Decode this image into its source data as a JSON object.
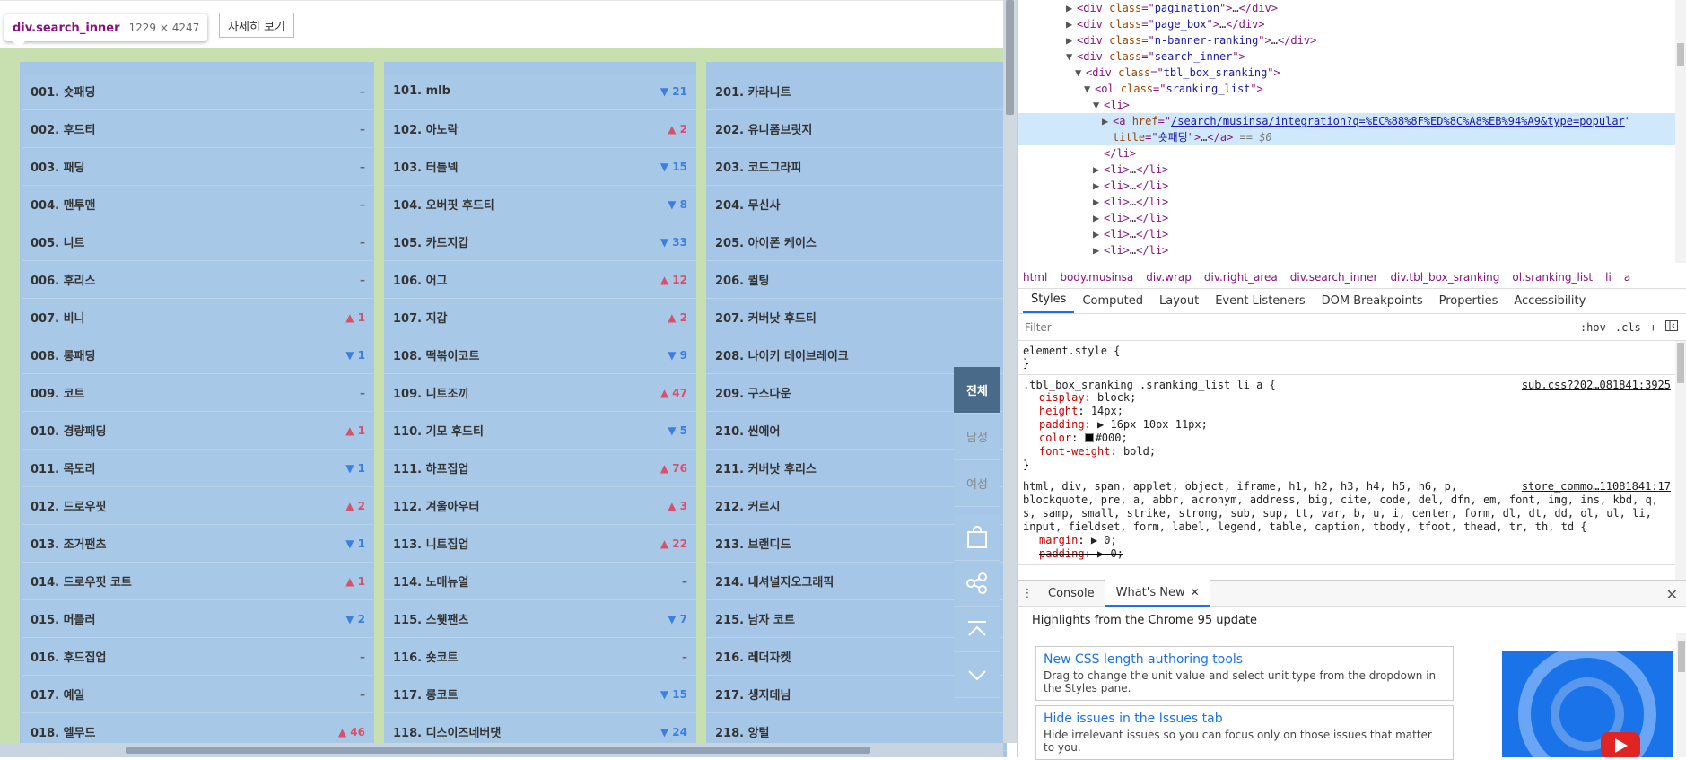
{
  "tooltip": {
    "tag": "div.search_inner",
    "size": "1229 × 4247"
  },
  "detail_button": "자세히 보기",
  "ranking": {
    "col1": [
      {
        "name": "001. 숏패딩",
        "change": "–",
        "dir": "same"
      },
      {
        "name": "002. 후드티",
        "change": "–",
        "dir": "same"
      },
      {
        "name": "003. 패딩",
        "change": "–",
        "dir": "same"
      },
      {
        "name": "004. 맨투맨",
        "change": "–",
        "dir": "same"
      },
      {
        "name": "005. 니트",
        "change": "–",
        "dir": "same"
      },
      {
        "name": "006. 후리스",
        "change": "–",
        "dir": "same"
      },
      {
        "name": "007. 비니",
        "change": "▲ 1",
        "dir": "up"
      },
      {
        "name": "008. 롱패딩",
        "change": "▼ 1",
        "dir": "down"
      },
      {
        "name": "009. 코트",
        "change": "–",
        "dir": "same"
      },
      {
        "name": "010. 경량패딩",
        "change": "▲ 1",
        "dir": "up"
      },
      {
        "name": "011. 목도리",
        "change": "▼ 1",
        "dir": "down"
      },
      {
        "name": "012. 드로우핏",
        "change": "▲ 2",
        "dir": "up"
      },
      {
        "name": "013. 조거팬츠",
        "change": "▼ 1",
        "dir": "down"
      },
      {
        "name": "014. 드로우핏 코트",
        "change": "▲ 1",
        "dir": "up"
      },
      {
        "name": "015. 머플러",
        "change": "▼ 2",
        "dir": "down"
      },
      {
        "name": "016. 후드집업",
        "change": "–",
        "dir": "same"
      },
      {
        "name": "017. 예일",
        "change": "–",
        "dir": "same"
      },
      {
        "name": "018. 엘무드",
        "change": "▲ 46",
        "dir": "up"
      }
    ],
    "col2": [
      {
        "name": "101. mlb",
        "change": "▼ 21",
        "dir": "down"
      },
      {
        "name": "102. 아노락",
        "change": "▲ 2",
        "dir": "up"
      },
      {
        "name": "103. 터틀넥",
        "change": "▼ 15",
        "dir": "down"
      },
      {
        "name": "104. 오버핏 후드티",
        "change": "▼ 8",
        "dir": "down"
      },
      {
        "name": "105. 카드지갑",
        "change": "▼ 33",
        "dir": "down"
      },
      {
        "name": "106. 어그",
        "change": "▲ 12",
        "dir": "up"
      },
      {
        "name": "107. 지갑",
        "change": "▲ 2",
        "dir": "up"
      },
      {
        "name": "108. 떡볶이코트",
        "change": "▼ 9",
        "dir": "down"
      },
      {
        "name": "109. 니트조끼",
        "change": "▲ 47",
        "dir": "up"
      },
      {
        "name": "110. 기모 후드티",
        "change": "▼ 5",
        "dir": "down"
      },
      {
        "name": "111. 하프집업",
        "change": "▲ 76",
        "dir": "up"
      },
      {
        "name": "112. 겨울아우터",
        "change": "▲ 3",
        "dir": "up"
      },
      {
        "name": "113. 니트집업",
        "change": "▲ 22",
        "dir": "up"
      },
      {
        "name": "114. 노매뉴얼",
        "change": "–",
        "dir": "same"
      },
      {
        "name": "115. 스웻팬츠",
        "change": "▼ 7",
        "dir": "down"
      },
      {
        "name": "116. 숏코트",
        "change": "–",
        "dir": "same"
      },
      {
        "name": "117. 롱코트",
        "change": "▼ 15",
        "dir": "down"
      },
      {
        "name": "118. 디스이즈네버댓",
        "change": "▼ 24",
        "dir": "down"
      }
    ],
    "col3": [
      {
        "name": "201. 카라니트"
      },
      {
        "name": "202. 유니폼브릿지"
      },
      {
        "name": "203. 코드그라피"
      },
      {
        "name": "204. 무신사"
      },
      {
        "name": "205. 아이폰 케이스"
      },
      {
        "name": "206. 퀼팅"
      },
      {
        "name": "207. 커버낫 후드티"
      },
      {
        "name": "208. 나이키 데이브레이크"
      },
      {
        "name": "209. 구스다운"
      },
      {
        "name": "210. 씬에어"
      },
      {
        "name": "211. 커버낫 후리스"
      },
      {
        "name": "212. 커르시"
      },
      {
        "name": "213. 브랜디드"
      },
      {
        "name": "214. 내셔널지오그래픽"
      },
      {
        "name": "215. 남자 코트"
      },
      {
        "name": "216. 레더자켓"
      },
      {
        "name": "217. 생지데님"
      },
      {
        "name": "218. 앙털"
      }
    ]
  },
  "side_tabs": [
    "전체",
    "남성",
    "여성"
  ],
  "side_tools": [
    "bag-icon",
    "share-icon",
    "scroll-top-icon",
    "scroll-down-icon"
  ],
  "dom": {
    "lines": [
      {
        "indent": 5,
        "tri": "▶",
        "html": "<span class='tag'>&lt;div </span><span class='attr'>class</span><span class='tag'>=\"</span><span class='val'>pagination</span><span class='tag'>\"&gt;</span>…<span class='tag'>&lt;/div&gt;</span>"
      },
      {
        "indent": 5,
        "tri": "▶",
        "html": "<span class='tag'>&lt;div </span><span class='attr'>class</span><span class='tag'>=\"</span><span class='val'>page_box</span><span class='tag'>\"&gt;</span>…<span class='tag'>&lt;/div&gt;</span>"
      },
      {
        "indent": 5,
        "tri": "▶",
        "html": "<span class='tag'>&lt;div </span><span class='attr'>class</span><span class='tag'>=\"</span><span class='val'>n-banner-ranking</span><span class='tag'>\"&gt;</span>…<span class='tag'>&lt;/div&gt;</span>"
      },
      {
        "indent": 5,
        "tri": "▼",
        "html": "<span class='tag'>&lt;div </span><span class='attr'>class</span><span class='tag'>=\"</span><span class='val'>search_inner</span><span class='tag'>\"&gt;</span>"
      },
      {
        "indent": 6,
        "tri": "▼",
        "html": "<span class='tag'>&lt;div </span><span class='attr'>class</span><span class='tag'>=\"</span><span class='val'>tbl_box_sranking</span><span class='tag'>\"&gt;</span>"
      },
      {
        "indent": 7,
        "tri": "▼",
        "html": "<span class='tag'>&lt;ol </span><span class='attr'>class</span><span class='tag'>=\"</span><span class='val'>sranking_list</span><span class='tag'>\"&gt;</span>"
      },
      {
        "indent": 8,
        "tri": "▼",
        "html": "<span class='tag'>&lt;li&gt;</span>"
      },
      {
        "indent": 9,
        "tri": "▶",
        "sel": true,
        "html": "<span class='tag'>&lt;a </span><span class='attr'>href</span><span class='tag'>=\"</span><span class='link'>/search/musinsa/integration?q=%EC%88%8F%ED%8C%A8%EB%94%A9&amp;type=popular</span><span class='tag'>\"</span>"
      },
      {
        "indent": 9,
        "tri": "",
        "sel": true,
        "html": "<span class='attr'>title</span><span class='tag'>=\"</span><span class='val'>숏패딩</span><span class='tag'>\"&gt;</span>…<span class='tag'>&lt;/a&gt;</span> <span style='color:#777;font-style:italic'>== $0</span>"
      },
      {
        "indent": 8,
        "tri": "",
        "html": "<span class='tag'>&lt;/li&gt;</span>"
      },
      {
        "indent": 8,
        "tri": "▶",
        "html": "<span class='tag'>&lt;li&gt;</span>…<span class='tag'>&lt;/li&gt;</span>"
      },
      {
        "indent": 8,
        "tri": "▶",
        "html": "<span class='tag'>&lt;li&gt;</span>…<span class='tag'>&lt;/li&gt;</span>"
      },
      {
        "indent": 8,
        "tri": "▶",
        "html": "<span class='tag'>&lt;li&gt;</span>…<span class='tag'>&lt;/li&gt;</span>"
      },
      {
        "indent": 8,
        "tri": "▶",
        "html": "<span class='tag'>&lt;li&gt;</span>…<span class='tag'>&lt;/li&gt;</span>"
      },
      {
        "indent": 8,
        "tri": "▶",
        "html": "<span class='tag'>&lt;li&gt;</span>…<span class='tag'>&lt;/li&gt;</span>"
      },
      {
        "indent": 8,
        "tri": "▶",
        "html": "<span class='tag'>&lt;li&gt;</span>…<span class='tag'>&lt;/li&gt;</span>"
      }
    ]
  },
  "breadcrumbs": [
    "html",
    "body.musinsa",
    "div.wrap",
    "div.right_area",
    "div.search_inner",
    "div.tbl_box_sranking",
    "ol.sranking_list",
    "li",
    "a"
  ],
  "style_tabs": [
    "Styles",
    "Computed",
    "Layout",
    "Event Listeners",
    "DOM Breakpoints",
    "Properties",
    "Accessibility"
  ],
  "filter": {
    "placeholder": "Filter",
    "hov": ":hov",
    "cls": ".cls",
    "plus": "+"
  },
  "rules": {
    "element": "element.style {",
    "r1_selector": ".tbl_box_sranking .sranking_list li a {",
    "r1_source": "sub.css?202…081841:3925",
    "r1_props": [
      {
        "name": "display",
        "value": "block;"
      },
      {
        "name": "height",
        "value": "14px;"
      },
      {
        "name": "padding",
        "value": "▶ 16px 10px 11px;"
      },
      {
        "name": "color",
        "value": "#000;",
        "swatch": true
      },
      {
        "name": "font-weight",
        "value": "bold;"
      }
    ],
    "r2_selector": "html, div, span, applet, object, iframe, h1, h2, h3, h4, h5, h6, p, blockquote, pre, a, abbr, acronym, address, big, cite, code, del, dfn, em, font, img, ins, kbd, q, s, samp, small, strike, strong, sub, sup, tt, var, b, u, i, center, form, dl, dt, dd, ol, ul, li, input, fieldset, form, label, legend, table, caption, tbody, tfoot, thead, tr, th, td {",
    "r2_source": "store_commo…11081841:17",
    "r2_props": [
      {
        "name": "margin",
        "value": "▶ 0;"
      },
      {
        "name": "padding",
        "value": "▶ 0;",
        "struck": true
      }
    ]
  },
  "drawer": {
    "tabs": [
      "Console",
      "What's New"
    ],
    "close": "✕"
  },
  "whatsnew": {
    "heading": "Highlights from the Chrome 95 update",
    "cards": [
      {
        "title": "New CSS length authoring tools",
        "desc": "Drag to change the unit value and select unit type from the dropdown in the Styles pane."
      },
      {
        "title": "Hide issues in the Issues tab",
        "desc": "Hide irrelevant issues so you can focus only on those issues that matter to you."
      }
    ]
  },
  "colors": {
    "up": "#d9506b",
    "down": "#3d7fe0",
    "overlay_blue": "#a6c6e7",
    "overlay_green": "#c8dfb0",
    "selected_row": "#cfe8fc"
  }
}
